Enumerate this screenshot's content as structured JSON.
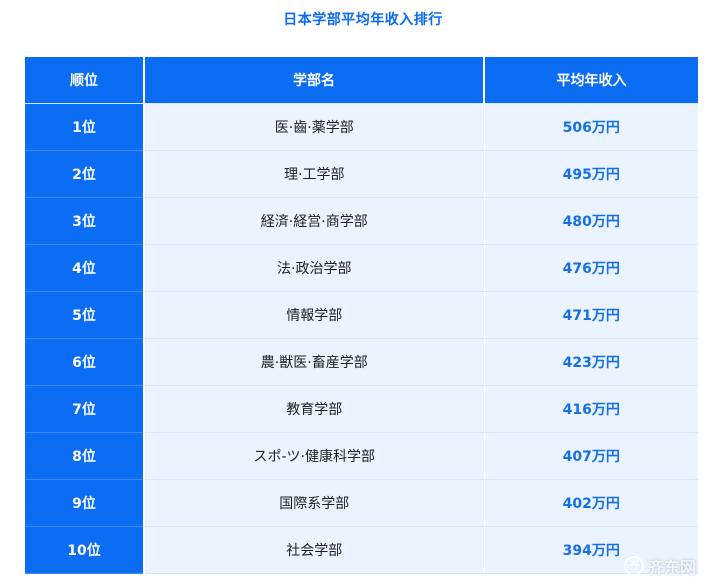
{
  "title": "日本学部平均年收入排行",
  "table": {
    "headers": [
      "顺位",
      "学部名",
      "平均年收入"
    ],
    "rows": [
      {
        "rank": "1位",
        "faculty": "医·齒·薬学部",
        "income": "506万円"
      },
      {
        "rank": "2位",
        "faculty": "理·工学部",
        "income": "495万円"
      },
      {
        "rank": "3位",
        "faculty": "経済·経営·商学部",
        "income": "480万円"
      },
      {
        "rank": "4位",
        "faculty": "法·政治学部",
        "income": "476万円"
      },
      {
        "rank": "5位",
        "faculty": "情報学部",
        "income": "471万円"
      },
      {
        "rank": "6位",
        "faculty": "農·獣医·畜産学部",
        "income": "423万円"
      },
      {
        "rank": "7位",
        "faculty": "教育学部",
        "income": "416万円"
      },
      {
        "rank": "8位",
        "faculty": "スポ-ツ·健康科学部",
        "income": "407万円"
      },
      {
        "rank": "9位",
        "faculty": "国際系学部",
        "income": "402万円"
      },
      {
        "rank": "10位",
        "faculty": "社会学部",
        "income": "394万円"
      }
    ]
  },
  "watermark": {
    "mark": "齐",
    "text": "齐东网"
  },
  "colors": {
    "header_bg": "#0b6cf4",
    "row_bg": "#eaf3ff",
    "income_text": "#1470e6",
    "title_text": "#0d6bf2"
  }
}
